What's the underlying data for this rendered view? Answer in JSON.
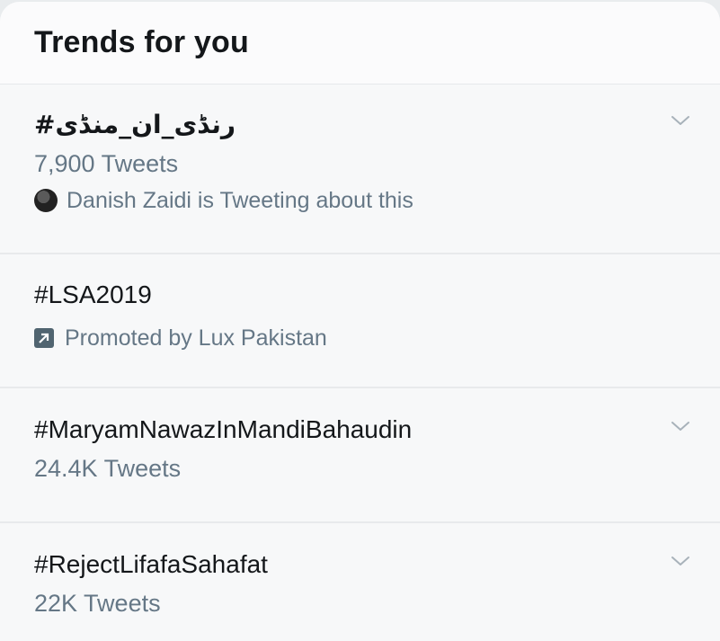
{
  "header": {
    "title": "Trends for you"
  },
  "trends": [
    {
      "tag": "#رنڈی_ان_منڈی",
      "count": "7,900 Tweets",
      "context": "Danish Zaidi is Tweeting about this"
    },
    {
      "tag": "#LSA2019",
      "promoted": "Promoted by Lux Pakistan"
    },
    {
      "tag": "#MaryamNawazInMandiBahaudin",
      "count": "24.4K Tweets"
    },
    {
      "tag": "#RejectLifafaSahafat",
      "count": "22K Tweets"
    }
  ],
  "icons": {
    "chevron": "chevron-down-icon",
    "promoted": "promoted-arrow-icon",
    "avatar": "avatar"
  },
  "colors": {
    "text_primary": "#14171a",
    "text_secondary": "#657786",
    "divider": "#e8eaec"
  }
}
